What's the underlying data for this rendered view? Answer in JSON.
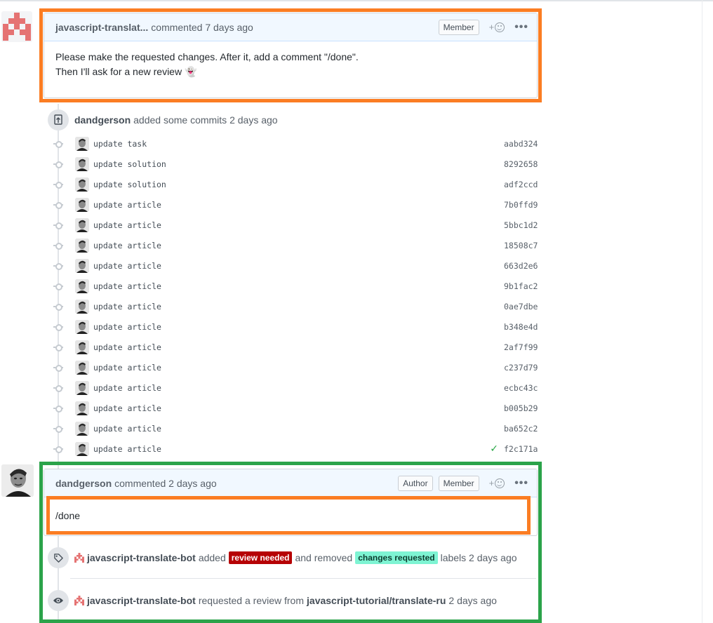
{
  "comment1": {
    "author": "javascript-translat...",
    "meta": "commented 7 days ago",
    "badge": "Member",
    "react_plus": "+",
    "more": "•••",
    "body_line1": "Please make the requested changes. After it, add a comment \"/done\".",
    "body_line2": "Then I'll ask for a new review",
    "emoji": "👻"
  },
  "commits": {
    "author": "dandgerson",
    "text": "added some commits 2 days ago",
    "items": [
      {
        "msg": "update task",
        "sha": "aabd324"
      },
      {
        "msg": "update solution",
        "sha": "8292658"
      },
      {
        "msg": "update solution",
        "sha": "adf2ccd"
      },
      {
        "msg": "update article",
        "sha": "7b0ffd9"
      },
      {
        "msg": "update article",
        "sha": "5bbc1d2"
      },
      {
        "msg": "update article",
        "sha": "18508c7"
      },
      {
        "msg": "update article",
        "sha": "663d2e6"
      },
      {
        "msg": "update article",
        "sha": "9b1fac2"
      },
      {
        "msg": "update article",
        "sha": "0ae7dbe"
      },
      {
        "msg": "update article",
        "sha": "b348e4d"
      },
      {
        "msg": "update article",
        "sha": "2af7f99"
      },
      {
        "msg": "update article",
        "sha": "c237d79"
      },
      {
        "msg": "update article",
        "sha": "ecbc43c"
      },
      {
        "msg": "update article",
        "sha": "b005b29"
      },
      {
        "msg": "update article",
        "sha": "ba652c2"
      },
      {
        "msg": "update article",
        "sha": "f2c171a",
        "check": "✓"
      }
    ]
  },
  "comment2": {
    "author": "dandgerson",
    "meta": "commented 2 days ago",
    "badge_author": "Author",
    "badge_member": "Member",
    "react_plus": "+",
    "more": "•••",
    "body": "/done"
  },
  "event_labels": {
    "actor": "javascript-translate-bot",
    "added": "added",
    "label_added": "review needed",
    "removed": "and removed",
    "label_removed": "changes requested",
    "tail": "labels 2 days ago",
    "label_added_color": "#b60205",
    "label_removed_color": "#7ef4d3"
  },
  "event_review": {
    "actor": "javascript-translate-bot",
    "text": "requested a review from",
    "team": "javascript-tutorial/translate-ru",
    "time": "2 days ago"
  }
}
